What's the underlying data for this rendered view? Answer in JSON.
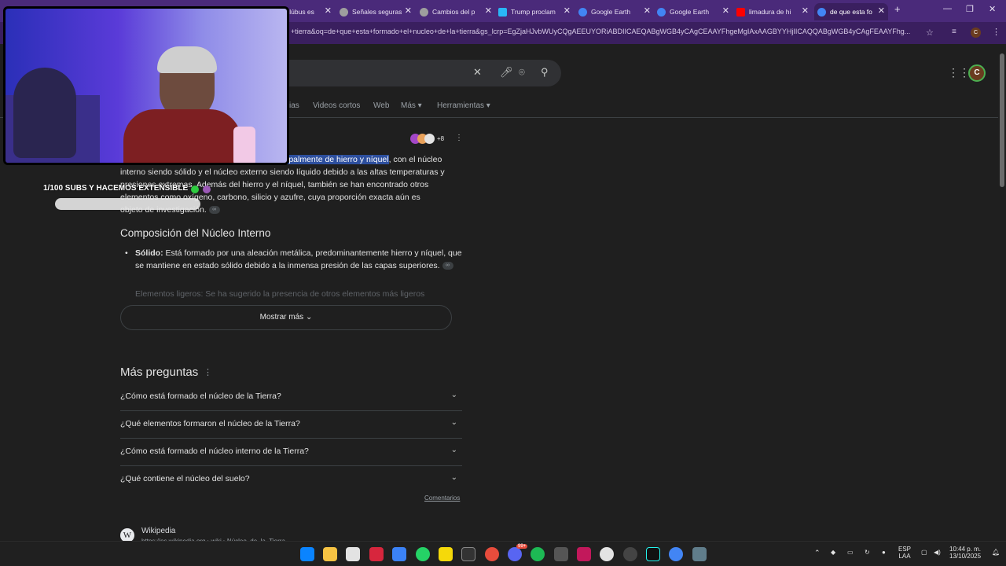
{
  "browser": {
    "tabs": [
      {
        "title": "clúbus es",
        "color": "#9ccc65"
      },
      {
        "title": "Señales seguras",
        "color": "#9e9e9e"
      },
      {
        "title": "Cambios del p",
        "color": "#9e9e9e"
      },
      {
        "title": "Trump proclam",
        "color": "#29b6f6"
      },
      {
        "title": "Google Earth",
        "color": "#4285f4"
      },
      {
        "title": "Google Earth",
        "color": "#4285f4"
      },
      {
        "title": "limadura de hi",
        "color": "#ff0000"
      },
      {
        "title": "de que esta fo",
        "color": "#4285f4"
      }
    ],
    "new_tab": "+",
    "url": "+tierra&oq=de+que+esta+formado+el+nucleo+de+la+tierra&gs_lcrp=EgZjaHJvbWUyCQgAEEUYORiABDIICAEQABgWGB4yCAgCEAAYFhgeMgIAxAAGBYYHjIICAQQABgWGB4yCAgFEAAYFhg...",
    "profile_initial": "C"
  },
  "google": {
    "nav_tabs": [
      "ias",
      "Videos cortos",
      "Web",
      "Más",
      "Herramientas"
    ],
    "sources_count": "+8",
    "overview": {
      "highlighted": "ipalmente de hierro y níquel",
      "line1_rest": ", con el núcleo",
      "line2": "interno siendo sólido y el núcleo externo siendo líquido debido a las altas temperaturas y",
      "line3": "presiones extremas. Además del hierro y el níquel, también se han encontrado otros",
      "line4": "elementos como oxígeno, carbono, silicio y azufre, cuya proporción exacta aún es",
      "line5": "objeto de investigación."
    },
    "composition": {
      "title": "Composición del Núcleo Interno",
      "solid_label": "Sólido:",
      "solid_text": "Está formado por una aleación metálica, predominantemente hierro y níquel, que se mantiene en estado sólido debido a la inmensa presión de las capas superiores.",
      "faded_item": "Elementos ligeros: Se ha sugerido la presencia de otros elementos más ligeros"
    },
    "show_more": "Mostrar más",
    "more_questions": {
      "title": "Más preguntas",
      "items": [
        "¿Cómo está formado el núcleo de la Tierra?",
        "¿Qué elementos formaron el núcleo de la Tierra?",
        "¿Cómo está formado el núcleo interno de la Tierra?",
        "¿Qué contiene el núcleo del suelo?"
      ]
    },
    "feedback": "Comentarios",
    "result": {
      "source": "Wikipedia",
      "url": "https://es.wikipedia.org › wiki › Núcleo_de_la_Tierra"
    }
  },
  "overlay": {
    "subs_text": "1/100 SUBS Y HACEMOS EXTENSIBLE"
  },
  "taskbar": {
    "lang_top": "ESP",
    "lang_bottom": "LAA",
    "time": "10:44 p. m.",
    "date": "13/10/2025",
    "badge_count": "99+"
  }
}
